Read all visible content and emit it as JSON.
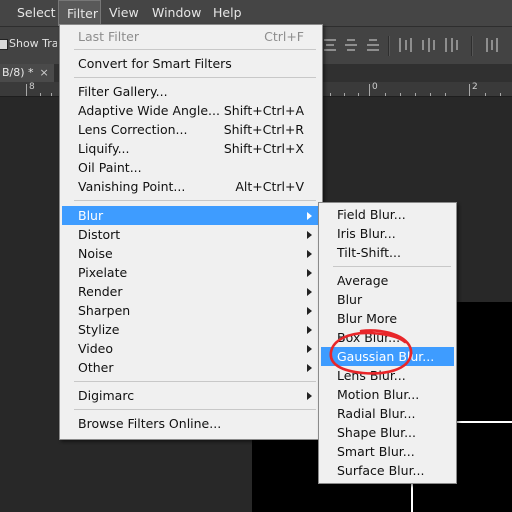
{
  "menubar": {
    "items": [
      "Select",
      "Filter",
      "View",
      "Window",
      "Help"
    ],
    "active": "Filter"
  },
  "options_bar": {
    "show_transform_label": "Show Transform Controls"
  },
  "document_tab": {
    "title": "B/8) *",
    "close": "×"
  },
  "ruler": {
    "numbers": [
      "8",
      "0",
      "2"
    ]
  },
  "filter_menu": {
    "last_filter": {
      "label": "Last Filter",
      "shortcut": "Ctrl+F",
      "disabled": true
    },
    "convert": "Convert for Smart Filters",
    "group1": [
      {
        "label": "Filter Gallery...",
        "shortcut": ""
      },
      {
        "label": "Adaptive Wide Angle...",
        "shortcut": "Shift+Ctrl+A"
      },
      {
        "label": "Lens Correction...",
        "shortcut": "Shift+Ctrl+R"
      },
      {
        "label": "Liquify...",
        "shortcut": "Shift+Ctrl+X"
      },
      {
        "label": "Oil Paint...",
        "shortcut": ""
      },
      {
        "label": "Vanishing Point...",
        "shortcut": "Alt+Ctrl+V"
      }
    ],
    "submenus": [
      "Blur",
      "Distort",
      "Noise",
      "Pixelate",
      "Render",
      "Sharpen",
      "Stylize",
      "Video",
      "Other"
    ],
    "highlighted": "Blur",
    "digimarc": "Digimarc",
    "browse": "Browse Filters Online..."
  },
  "blur_menu": {
    "group1": [
      "Field Blur...",
      "Iris Blur...",
      "Tilt-Shift..."
    ],
    "group2": [
      "Average",
      "Blur",
      "Blur More",
      "Box Blur...",
      "Gaussian Blur...",
      "Lens Blur...",
      "Motion Blur...",
      "Radial Blur...",
      "Shape Blur...",
      "Smart Blur...",
      "Surface Blur..."
    ],
    "highlighted": "Gaussian Blur..."
  },
  "colors": {
    "highlight": "#3e9cff",
    "annotation_circle": "#e8262a",
    "menu_bg": "#f0f0f0",
    "app_bg": "#282828"
  },
  "icons": [
    "checkbox-icon",
    "align-top-icon",
    "align-vcenter-icon",
    "align-bottom-icon",
    "align-left-icon",
    "align-hcenter-icon",
    "align-right-icon",
    "distribute-icon",
    "submenu-arrow-icon"
  ]
}
